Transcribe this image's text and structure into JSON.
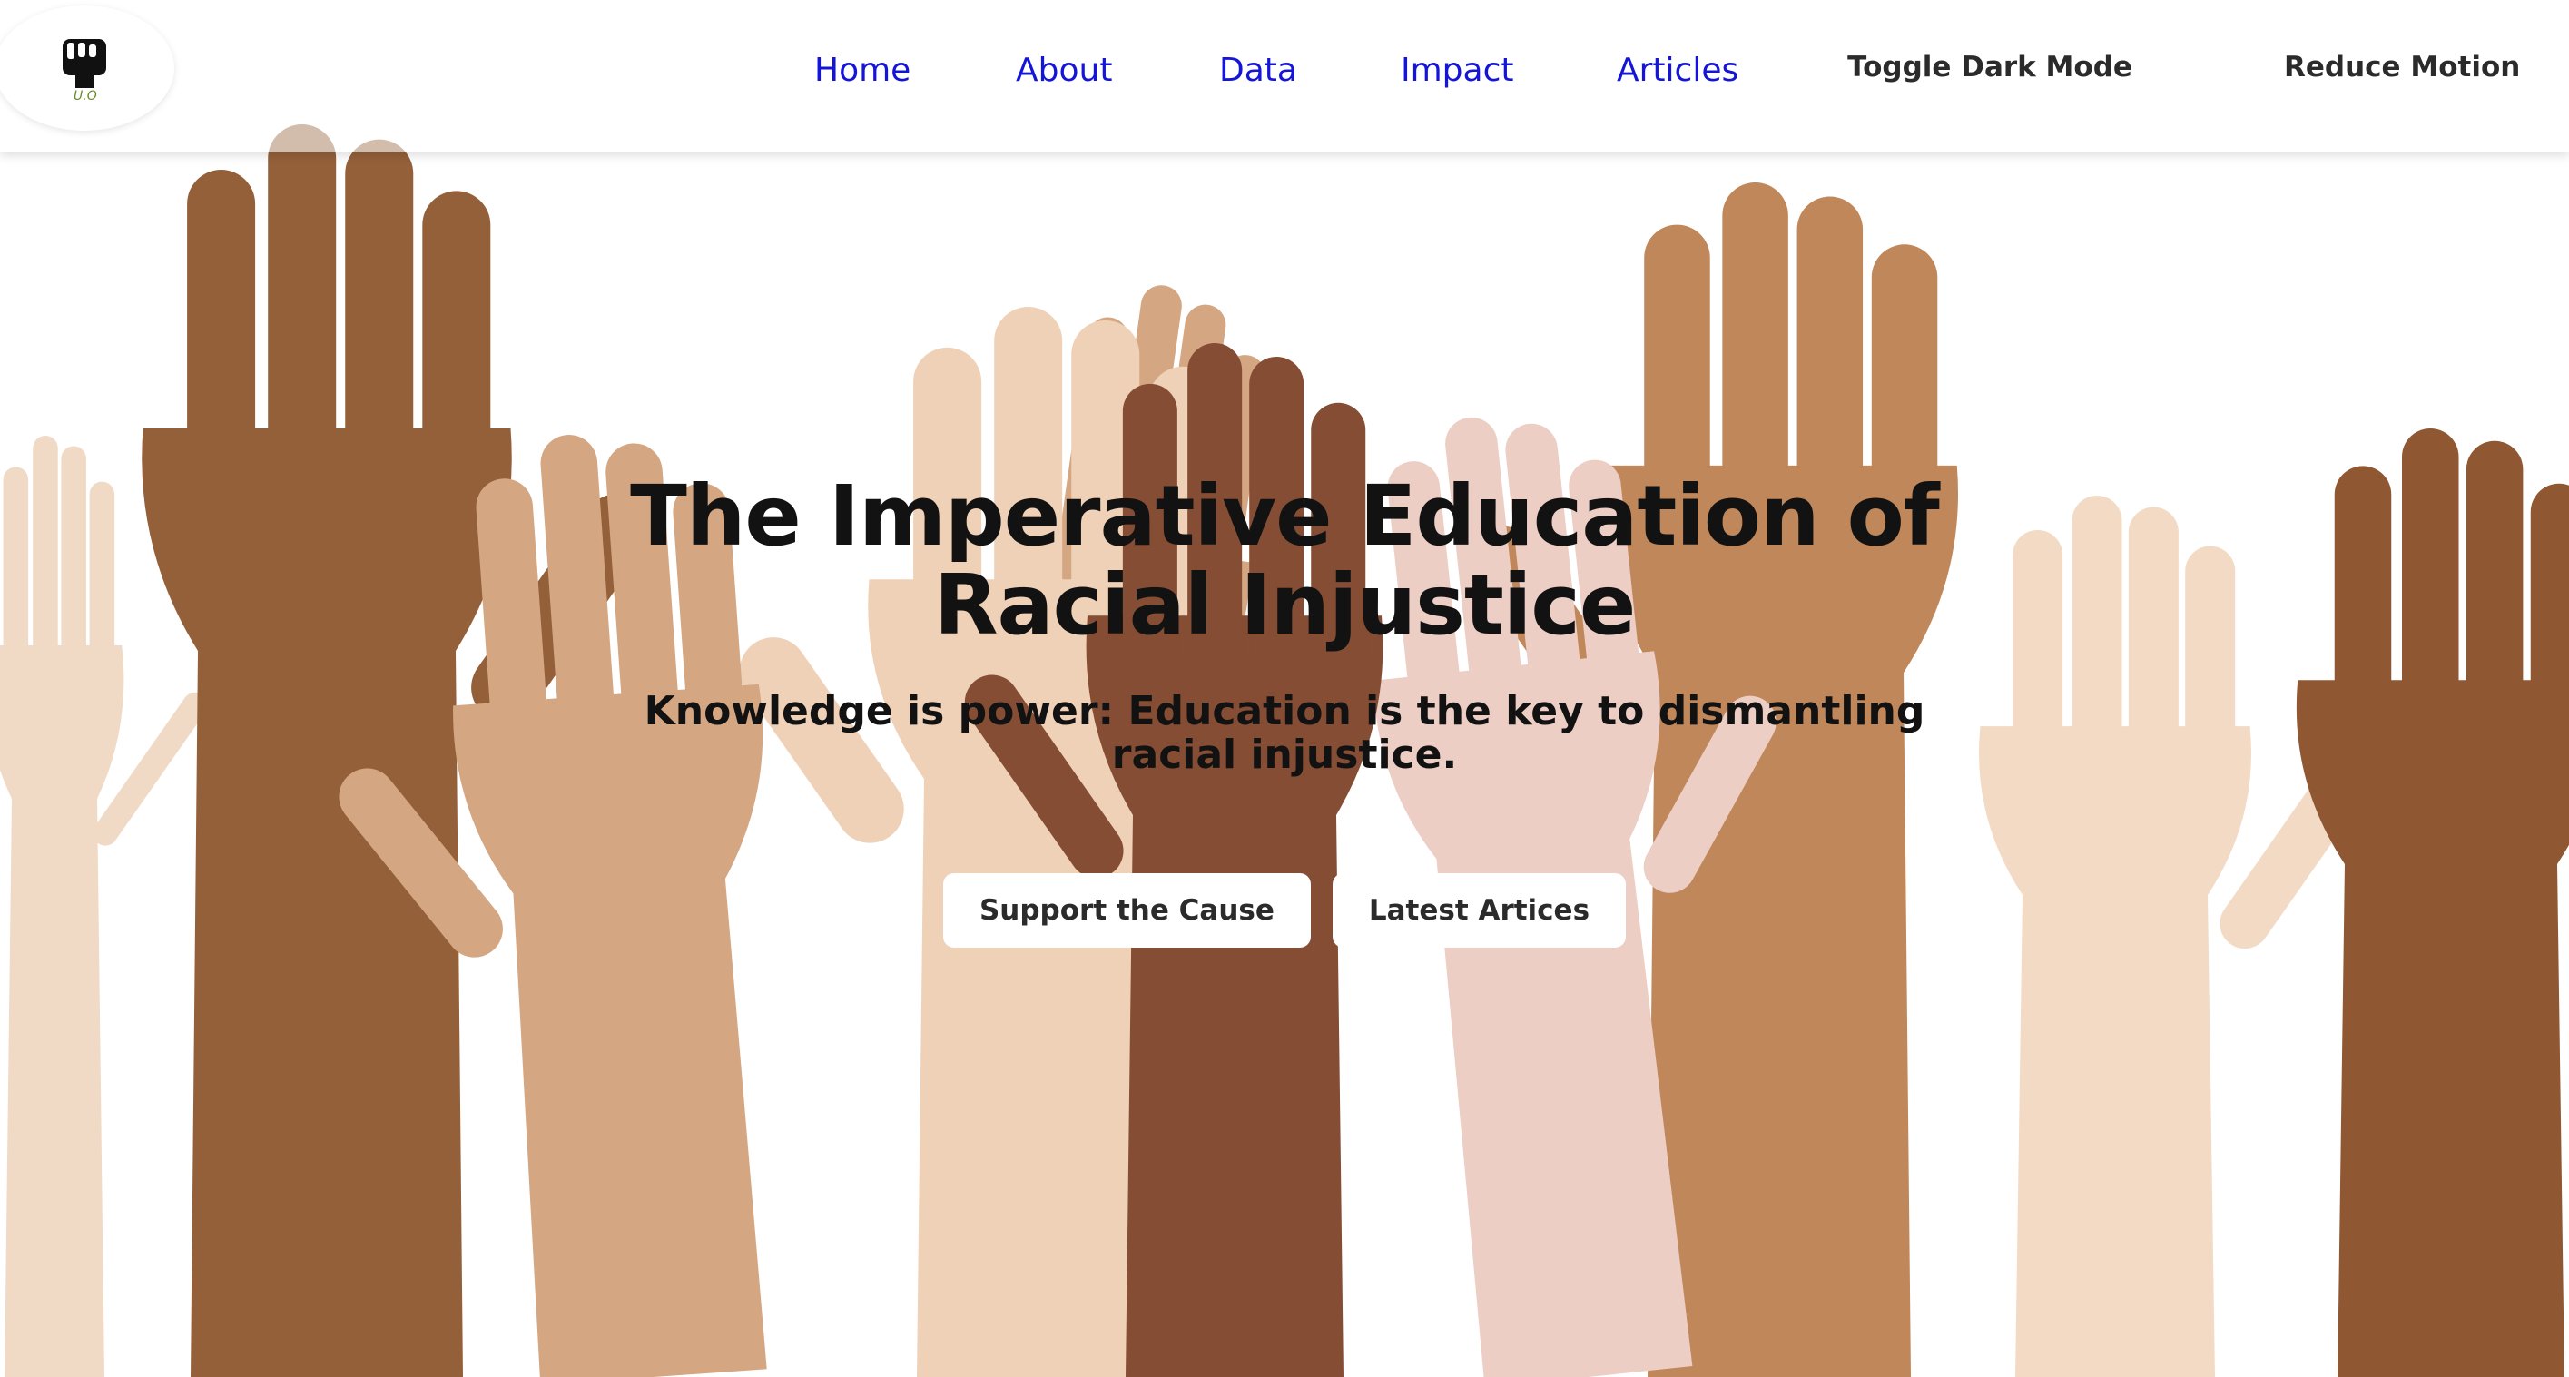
{
  "nav": {
    "logo_icon": "raised-fist-icon",
    "links": [
      {
        "label": "Home"
      },
      {
        "label": "About"
      },
      {
        "label": "Data"
      },
      {
        "label": "Impact"
      },
      {
        "label": "Articles"
      }
    ],
    "dark_mode_label": "Toggle Dark Mode",
    "reduce_motion_label": "Reduce Motion",
    "link_color": "#1515d8"
  },
  "hero": {
    "title": "The Imperative Education of Racial Injustice",
    "subtitle": "Knowledge is power: Education is the key to dismantling racial injustice.",
    "primary_button": "Support the Cause",
    "secondary_button": "Latest Artices"
  },
  "background": {
    "description_icon": "raised-hands-illustration",
    "skin_tones": [
      "#f0dac6",
      "#94603a",
      "#d4a682",
      "#efd1b7",
      "#844d34",
      "#eccec5",
      "#c0875a",
      "#f3dac4",
      "#8f5732"
    ]
  }
}
